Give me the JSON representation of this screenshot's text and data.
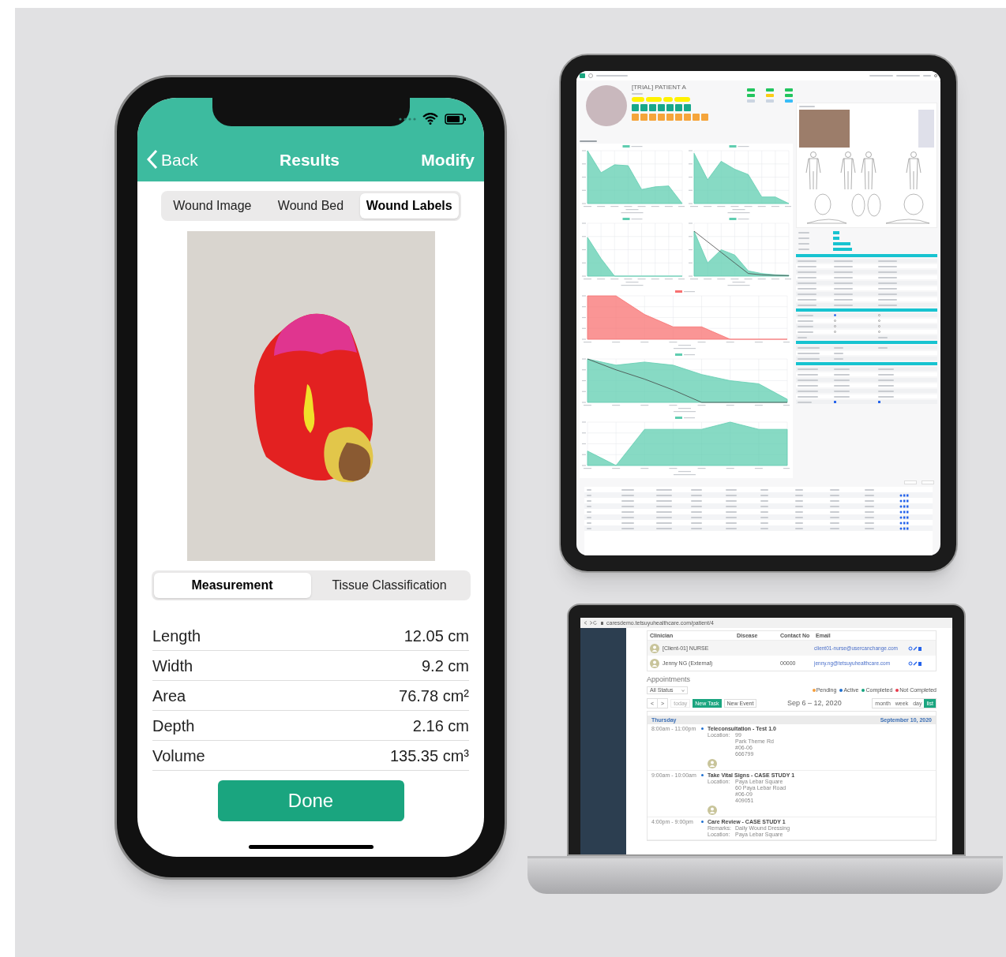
{
  "phone": {
    "nav": {
      "back": "Back",
      "title": "Results",
      "action": "Modify"
    },
    "image_tabs": [
      {
        "label": "Wound Image",
        "selected": false
      },
      {
        "label": "Wound Bed",
        "selected": false
      },
      {
        "label": "Wound Labels",
        "selected": true
      }
    ],
    "detail_tabs": [
      {
        "label": "Measurement",
        "selected": true
      },
      {
        "label": "Tissue Classification",
        "selected": false
      }
    ],
    "measurements": [
      {
        "label": "Length",
        "value": "12.05 cm"
      },
      {
        "label": "Width",
        "value": "9.2 cm"
      },
      {
        "label": "Area",
        "value": "76.78 cm²"
      },
      {
        "label": "Depth",
        "value": "2.16 cm"
      },
      {
        "label": "Volume",
        "value": "135.35 cm³"
      }
    ],
    "done": "Done"
  },
  "tablet": {
    "patient_name": "[TRIAL] PATIENT A",
    "vitals": [
      {
        "color": "#22c55e"
      },
      {
        "color": "#22c55e"
      },
      {
        "color": "#22c55e"
      },
      {
        "color": "#22c55e"
      },
      {
        "color": "#facc15"
      },
      {
        "color": "#22c55e"
      },
      {
        "color": "#cbd5e1"
      },
      {
        "color": "#cbd5e1"
      },
      {
        "color": "#38bdf8"
      }
    ],
    "radio_rows": [
      {
        "checks": [
          true,
          false
        ]
      },
      {
        "checks": [
          false,
          false
        ]
      },
      {
        "checks": [
          false,
          false
        ]
      },
      {
        "checks": [
          false,
          false
        ]
      }
    ],
    "checkbox_row": {
      "checks": [
        true,
        true
      ]
    }
  },
  "laptop": {
    "url": "caresdemo.tetsuyuhealthcare.com/patient/4",
    "columns": [
      "Clinician",
      "Disease",
      "Contact No",
      "Email"
    ],
    "clinicians": [
      {
        "name": "[Client-01] NURSE",
        "email": "client01-nurse@usercanchange.com"
      },
      {
        "name": "Jenny NG (External)",
        "contact": "00000",
        "email": "jenny.ng@tetsuyuhealthcare.com"
      }
    ],
    "appointments_title": "Appointments",
    "status_filter": "All Status",
    "legend": [
      {
        "label": "Pending",
        "color": "#f59e3b"
      },
      {
        "label": "Active",
        "color": "#1e6fd0"
      },
      {
        "label": "Completed",
        "color": "#14a37f"
      },
      {
        "label": "Not Completed",
        "color": "#e8394a"
      }
    ],
    "prev": "<",
    "next": ">",
    "today": "today",
    "new_task": "New Task",
    "new_event": "New Event",
    "range": "Sep 6 – 12, 2020",
    "views": [
      {
        "label": "month",
        "selected": false
      },
      {
        "label": "week",
        "selected": false
      },
      {
        "label": "day",
        "selected": false
      },
      {
        "label": "list",
        "selected": true
      }
    ],
    "day": "Thursday",
    "date": "September 10, 2020",
    "events": [
      {
        "time": "8:00am - 11:00pm",
        "title": "Teleconsultation - Test 1.0",
        "fields": [
          {
            "label": "Location:",
            "lines": [
              "99",
              "Park Theme Rd",
              "#06-06",
              "666799"
            ]
          }
        ],
        "avatar": true
      },
      {
        "time": "9:00am - 10:00am",
        "title": "Take Vital Signs - CASE STUDY 1",
        "fields": [
          {
            "label": "Location:",
            "lines": [
              "Paya Lebar Square",
              "60 Paya Lebar Road",
              "#06-09",
              "409051"
            ]
          }
        ],
        "avatar": true
      },
      {
        "time": "4:00pm - 9:00pm",
        "title": "Care Review - CASE STUDY 1",
        "fields": [
          {
            "label": "Remarks:",
            "lines": [
              "Daily Wound Dressing"
            ]
          },
          {
            "label": "Location:",
            "lines": [
              "Paya Lebar Square"
            ]
          }
        ],
        "avatar": false
      }
    ]
  }
}
